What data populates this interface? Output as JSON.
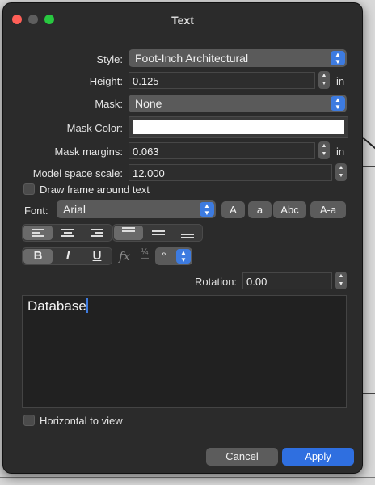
{
  "window": {
    "title": "Text"
  },
  "style": {
    "label": "Style:",
    "value": "Foot-Inch Architectural"
  },
  "height": {
    "label": "Height:",
    "value": "0.125",
    "unit": "in"
  },
  "mask": {
    "label": "Mask:",
    "value": "None"
  },
  "mask_color": {
    "label": "Mask Color:",
    "color": "#ffffff"
  },
  "mask_margins": {
    "label": "Mask margins:",
    "value": "0.063",
    "unit": "in"
  },
  "model_scale": {
    "label": "Model space scale:",
    "value": "12.000"
  },
  "draw_frame": {
    "label": "Draw frame around text",
    "checked": false
  },
  "font": {
    "label": "Font:",
    "value": "Arial",
    "case_buttons": [
      "A",
      "a",
      "Abc",
      "A-a"
    ]
  },
  "format": {
    "bold": "B",
    "italic": "I",
    "underline": "U",
    "fx": "fx",
    "degree": "°"
  },
  "rotation": {
    "label": "Rotation:",
    "value": "0.00"
  },
  "text_content": "Database",
  "horizontal": {
    "label": "Horizontal to view",
    "checked": false
  },
  "buttons": {
    "cancel": "Cancel",
    "apply": "Apply"
  },
  "colors": {
    "accent": "#3d7be0",
    "window_bg": "#2b2b2b"
  }
}
